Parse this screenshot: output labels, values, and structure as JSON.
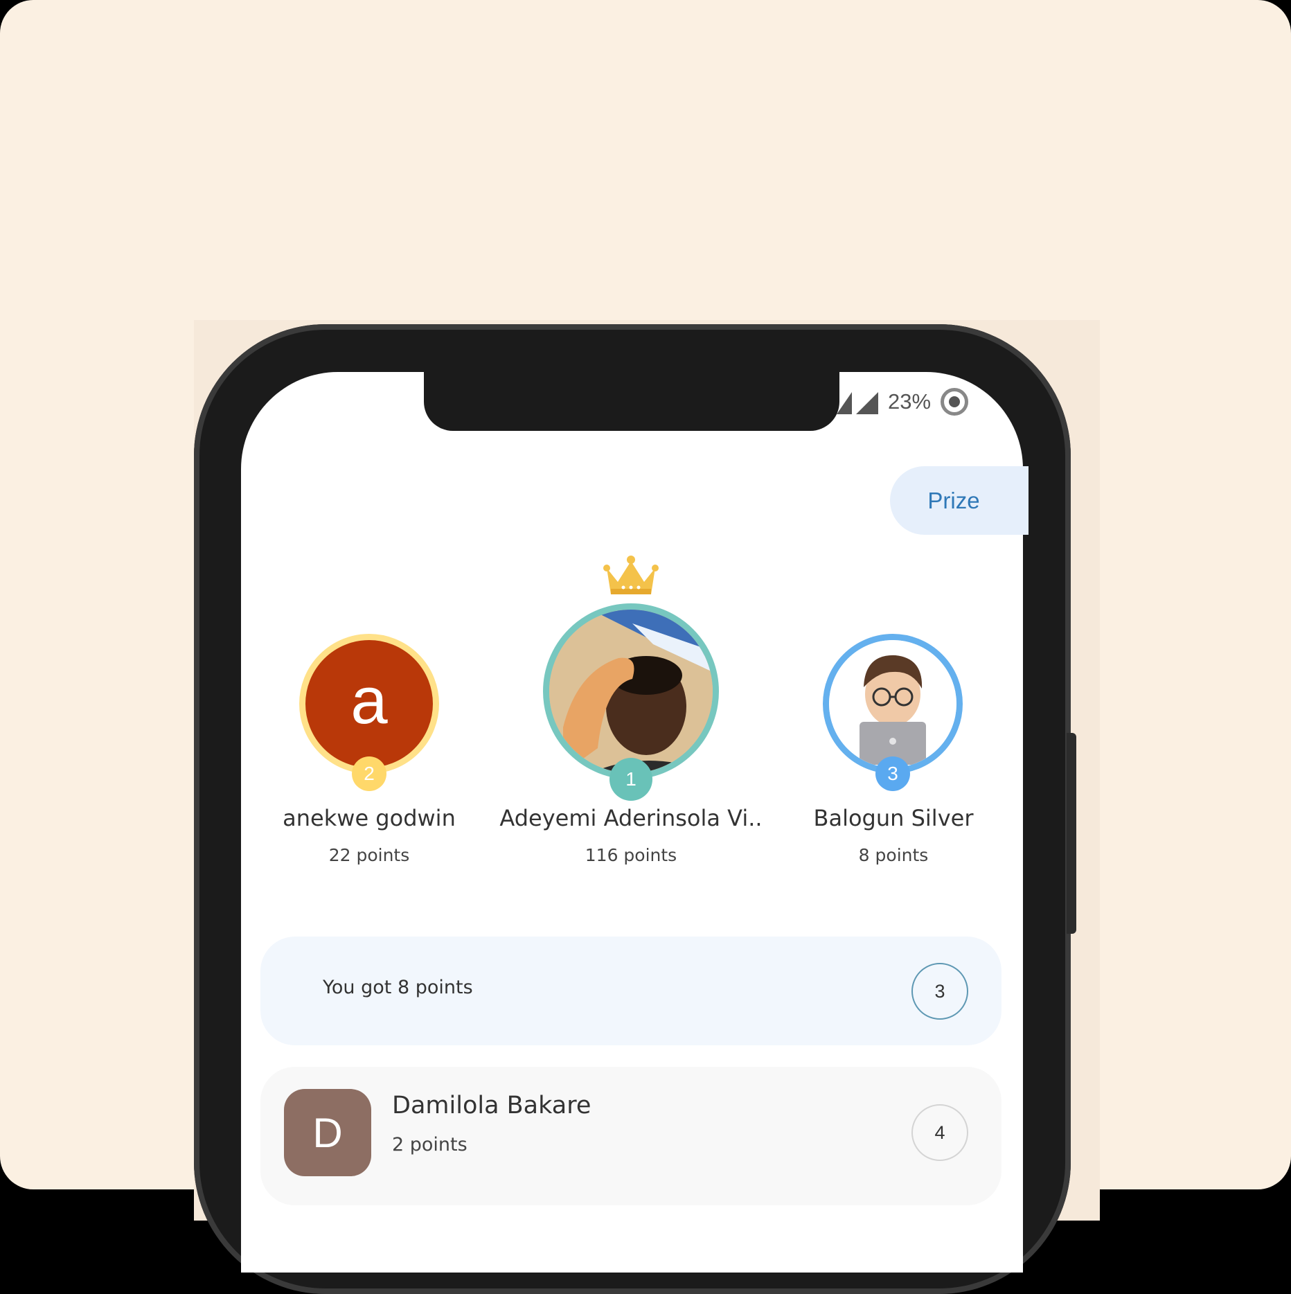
{
  "status_bar": {
    "battery_percent": "23%"
  },
  "header": {
    "prize_label": "Prize"
  },
  "podium": [
    {
      "rank": "2",
      "name": "anekwe godwin",
      "points": "22 points",
      "avatar_letter": "a",
      "ring_color": "#ffe189",
      "avatar_bg": "#b93809"
    },
    {
      "rank": "1",
      "name": "Adeyemi Aderinsola Vi..",
      "points": "116 points",
      "ring_color": "#77c7bf"
    },
    {
      "rank": "3",
      "name": "Balogun Silver",
      "points": "8 points",
      "ring_color": "#64b0ee"
    }
  ],
  "my_status": {
    "text": "You got 8 points",
    "rank": "3"
  },
  "leaderboard": [
    {
      "avatar_letter": "D",
      "name": "Damilola Bakare",
      "points": "2 points",
      "rank": "4",
      "avatar_color": "#8d6e63"
    }
  ],
  "icons": [
    "signal-icon",
    "battery-icon",
    "crown-icon"
  ]
}
